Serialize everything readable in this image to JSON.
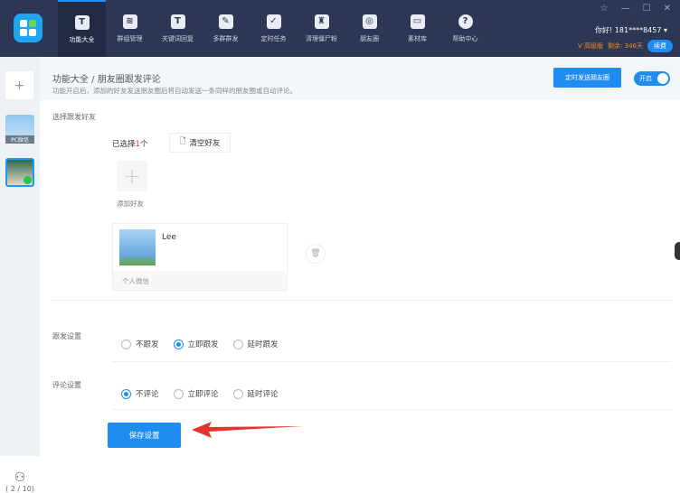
{
  "nav": [
    {
      "label": "功能大全",
      "icon": "T"
    },
    {
      "label": "群组管理",
      "icon": "≋"
    },
    {
      "label": "关键词回复",
      "icon": "T"
    },
    {
      "label": "多群群发",
      "icon": "✎"
    },
    {
      "label": "定时任务",
      "icon": "✓"
    },
    {
      "label": "清理僵尸粉",
      "icon": "♜"
    },
    {
      "label": "朋友圈",
      "icon": "◎"
    },
    {
      "label": "素材库",
      "icon": "▭"
    },
    {
      "label": "帮助中心",
      "icon": "?"
    }
  ],
  "window": {
    "pin": "☆",
    "min": "—",
    "max": "☐",
    "close": "✕"
  },
  "user": {
    "greeting": "你好! 181****8457 ▾",
    "plan": "V 高级版",
    "remaining": "剩余: 346天",
    "renew": "续费"
  },
  "sidebar": {
    "add": "+",
    "account_label": "PC微信",
    "count": "( 2 / 10)"
  },
  "header": {
    "breadcrumb": "功能大全 / 朋友圈跟发评论",
    "desc": "功能开启后，添加的好友发送朋友圈后将自动发送一条同样的朋友圈或自动评论。",
    "timed_button": "定时发送朋友圈",
    "toggle": "开启"
  },
  "friends": {
    "label": "选择跟发好友",
    "selected_prefix": "已选择",
    "selected_count": "1",
    "selected_suffix": "个",
    "clear": "清空好友",
    "add": "添加好友",
    "card_name": "Lee",
    "card_type": "个人微信"
  },
  "follow": {
    "label": "跟发设置",
    "options": [
      "不跟发",
      "立即跟发",
      "延时跟发"
    ],
    "selected": 1
  },
  "comment": {
    "label": "评论设置",
    "options": [
      "不评论",
      "立即评论",
      "延时评论"
    ],
    "selected": 0
  },
  "save": "保存设置"
}
